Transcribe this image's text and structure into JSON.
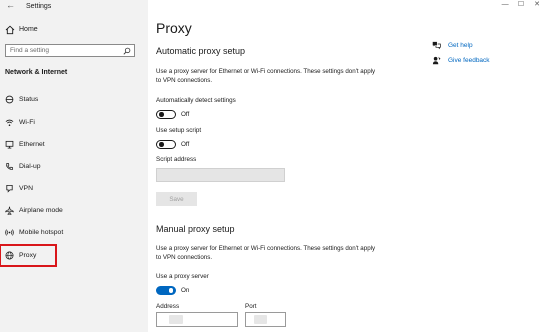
{
  "window": {
    "title": "Settings",
    "controls": [
      "—",
      "☐",
      "✕"
    ]
  },
  "sidebar": {
    "home_label": "Home",
    "search_placeholder": "Find a setting",
    "section_header": "Network & Internet",
    "items": [
      {
        "label": "Status",
        "icon": "status-icon"
      },
      {
        "label": "Wi-Fi",
        "icon": "wifi-icon"
      },
      {
        "label": "Ethernet",
        "icon": "ethernet-icon"
      },
      {
        "label": "Dial-up",
        "icon": "phone-icon"
      },
      {
        "label": "VPN",
        "icon": "vpn-icon"
      },
      {
        "label": "Airplane mode",
        "icon": "airplane-icon"
      },
      {
        "label": "Mobile hotspot",
        "icon": "hotspot-icon"
      },
      {
        "label": "Proxy",
        "icon": "globe-icon",
        "selected": true
      }
    ]
  },
  "main": {
    "title": "Proxy",
    "automatic": {
      "heading": "Automatic proxy setup",
      "description": "Use a proxy server for Ethernet or Wi-Fi connections. These settings don't apply to VPN connections.",
      "detect_label": "Automatically detect settings",
      "detect_state": "Off",
      "script_label": "Use setup script",
      "script_state": "Off",
      "script_address_label": "Script address",
      "script_address_value": "",
      "save_label": "Save"
    },
    "manual": {
      "heading": "Manual proxy setup",
      "description": "Use a proxy server for Ethernet or Wi-Fi connections. These settings don't apply to VPN connections.",
      "use_proxy_label": "Use a proxy server",
      "use_proxy_state": "On",
      "address_label": "Address",
      "port_label": "Port"
    },
    "help": {
      "get_help": "Get help",
      "give_feedback": "Give feedback"
    }
  },
  "colors": {
    "accent": "#0067c0",
    "sidebar_bg": "#f2f2f2",
    "highlight_box": "#d9161a"
  }
}
